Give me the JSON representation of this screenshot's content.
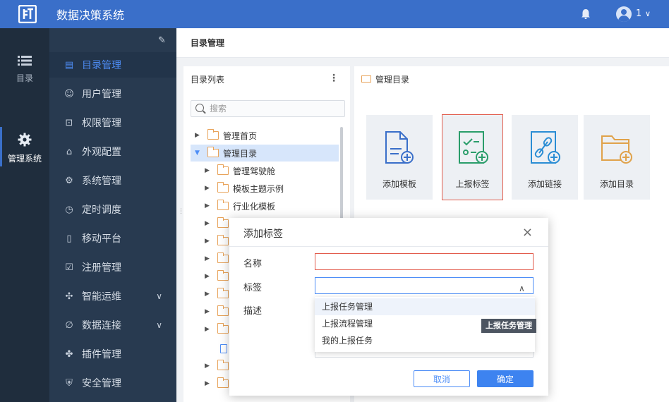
{
  "app": {
    "title": "数据决策系统",
    "user_name": "1",
    "user_chevron": "∨"
  },
  "rail": [
    {
      "label": "目录",
      "icon": "list-icon"
    },
    {
      "label": "管理系统",
      "icon": "gear-icon",
      "active": true
    }
  ],
  "nav": {
    "pin_icon": "pin-icon",
    "items": [
      {
        "label": "目录管理",
        "icon": "catalog-icon",
        "active": true
      },
      {
        "label": "用户管理",
        "icon": "user-icon"
      },
      {
        "label": "权限管理",
        "icon": "lock-icon"
      },
      {
        "label": "外观配置",
        "icon": "brush-icon"
      },
      {
        "label": "系统管理",
        "icon": "settings-icon"
      },
      {
        "label": "定时调度",
        "icon": "timer-icon"
      },
      {
        "label": "移动平台",
        "icon": "mobile-icon"
      },
      {
        "label": "注册管理",
        "icon": "register-icon"
      },
      {
        "label": "智能运维",
        "icon": "ops-icon",
        "expandable": true
      },
      {
        "label": "数据连接",
        "icon": "link-icon",
        "expandable": true
      },
      {
        "label": "插件管理",
        "icon": "plugin-icon"
      },
      {
        "label": "安全管理",
        "icon": "shield-icon"
      }
    ]
  },
  "breadcrumb": "目录管理",
  "dir_panel": {
    "title": "目录列表",
    "more": "⋮",
    "search_placeholder": "搜索",
    "tree": [
      {
        "label": "管理首页",
        "level": 0,
        "expanded": false
      },
      {
        "label": "管理目录",
        "level": 0,
        "expanded": true,
        "selected": true
      },
      {
        "label": "管理驾驶舱",
        "level": 1
      },
      {
        "label": "模板主题示例",
        "level": 1
      },
      {
        "label": "行业化模板",
        "level": 1
      }
    ]
  },
  "mgr_panel": {
    "title": "管理目录",
    "cards": [
      {
        "label": "添加模板",
        "icon": "add-template-icon"
      },
      {
        "label": "上报标签",
        "icon": "report-tag-icon",
        "highlight": true
      },
      {
        "label": "添加链接",
        "icon": "add-link-icon"
      },
      {
        "label": "添加目录",
        "icon": "add-folder-icon"
      }
    ]
  },
  "modal": {
    "title": "添加标签",
    "close": "×",
    "fields": {
      "name_label": "名称",
      "tag_label": "标签",
      "desc_label": "描述"
    },
    "name_value": "",
    "tag_value": "",
    "tag_options": [
      "上报任务管理",
      "上报流程管理",
      "我的上报任务"
    ],
    "cancel_label": "取消",
    "ok_label": "确定"
  },
  "tooltip": "上报任务管理",
  "colors": {
    "topbar": "#3a6fc9",
    "rail": "#1f2d3d",
    "nav": "#283a50",
    "accent": "#4e8ef7",
    "error": "#e25b4b"
  }
}
